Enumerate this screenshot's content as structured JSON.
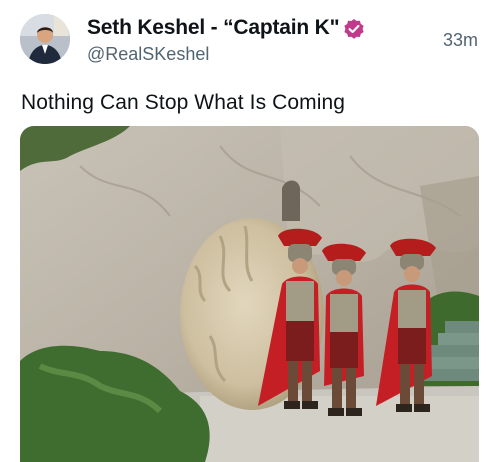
{
  "post": {
    "author": {
      "display_name": "Seth Keshel - “Captain K\"",
      "handle": "@RealSKeshel",
      "verified": true,
      "avatar_icon": "user-avatar-photo"
    },
    "time_ago": "33m",
    "text": "Nothing Can Stop What Is Coming",
    "media": {
      "type": "photo",
      "icon": "roman-soldiers-tomb-photo"
    }
  },
  "colors": {
    "text_primary": "#0f1419",
    "text_secondary": "#536471",
    "badge": "#c0398a",
    "cloak": "#c41f24",
    "crest": "#b51c1c"
  }
}
